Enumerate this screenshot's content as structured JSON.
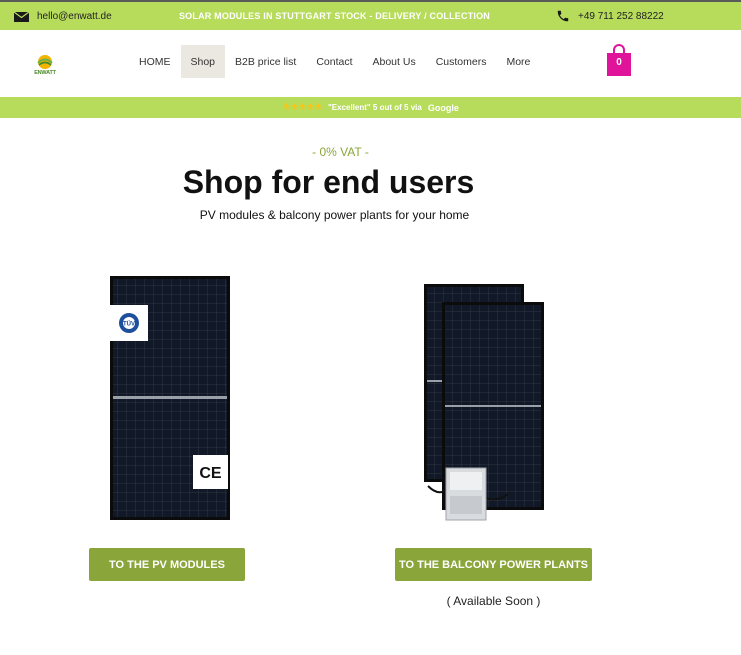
{
  "topbar": {
    "email": "hello@enwatt.de",
    "promo": "SOLAR MODULES IN STUTTGART STOCK - DELIVERY / COLLECTION",
    "phone": "+49 711 252 88222"
  },
  "header": {
    "logo_text": "ENWATT",
    "nav": [
      {
        "label": "HOME"
      },
      {
        "label": "Shop"
      },
      {
        "label": "B2B price list"
      },
      {
        "label": "Contact"
      },
      {
        "label": "About Us"
      },
      {
        "label": "Customers"
      },
      {
        "label": "More"
      }
    ],
    "active_nav": "Shop",
    "cart_count": "0"
  },
  "rating": {
    "stars": "★★★★★",
    "text": "\"Excellent\" 5 out of 5 via",
    "source": "Google",
    "rating_value": 5,
    "rating_max": 5
  },
  "hero": {
    "vat": "- 0% VAT -",
    "title": "Shop for end users",
    "subtitle": "PV modules & balcony power plants for your home"
  },
  "products": {
    "pv": {
      "button": "TO THE PV MODULES",
      "badges": [
        "TÜV",
        "CE"
      ]
    },
    "balcony": {
      "button": "TO THE BALCONY POWER PLANTS",
      "availability": "( Available Soon )"
    }
  },
  "colors": {
    "accent_green": "#b7dc5b",
    "button_green": "#8aa53a",
    "cart_pink": "#e0139b",
    "active_nav_bg": "#ebe7e1"
  }
}
